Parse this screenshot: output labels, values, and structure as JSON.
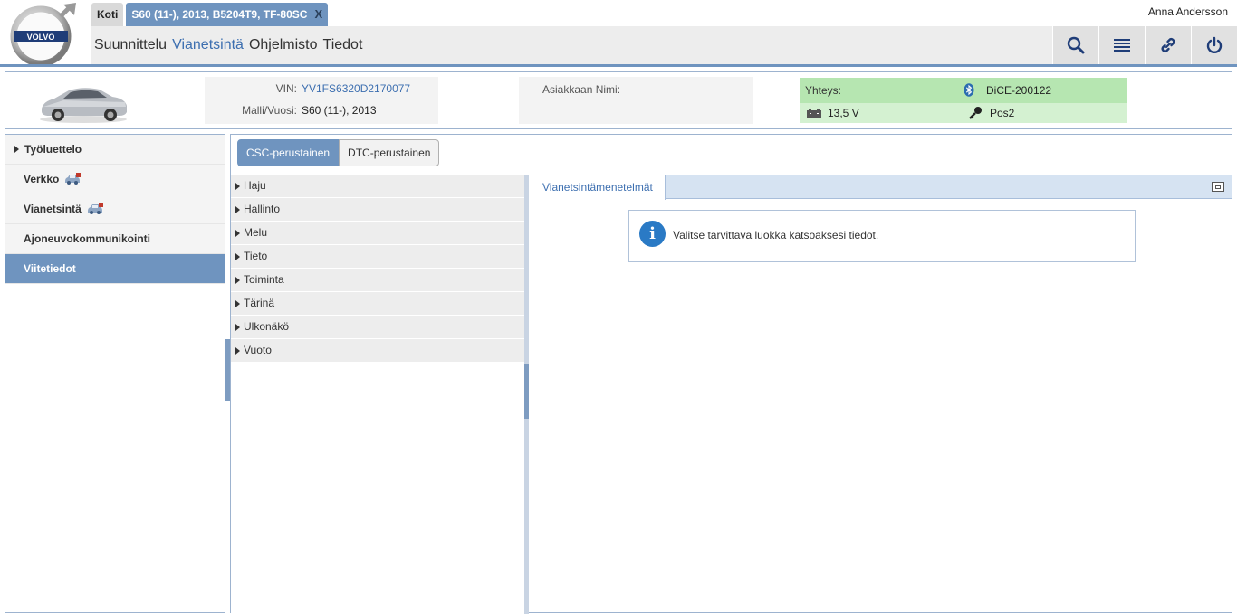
{
  "header": {
    "logo_text": "VOLVO",
    "tabs": {
      "home": "Koti",
      "vehicle": "S60 (11-), 2013, B5204T9, TF-80SC",
      "close": "X"
    },
    "user": "Anna Andersson",
    "nav": {
      "planning": "Suunnittelu",
      "diagnostics": "Vianetsintä",
      "software": "Ohjelmisto",
      "info": "Tiedot"
    },
    "toolbar_icons": [
      "search-icon",
      "list-icon",
      "link-icon",
      "power-icon"
    ]
  },
  "vehicle": {
    "vin_label": "VIN:",
    "vin": "YV1FS6320D2170077",
    "model_label": "Malli/Vuosi:",
    "model": "S60 (11-), 2013",
    "customer_label": "Asiakkaan Nimi:",
    "customer": "",
    "connection_label": "Yhteys:",
    "device": "DiCE-200122",
    "voltage": "13,5 V",
    "key_position": "Pos2"
  },
  "sidebar": {
    "items": [
      {
        "label": "Työluettelo"
      },
      {
        "label": "Verkko"
      },
      {
        "label": "Vianetsintä"
      },
      {
        "label": "Ajoneuvokommunikointi"
      },
      {
        "label": "Viitetiedot"
      }
    ],
    "active_index": 4
  },
  "content": {
    "subtabs": {
      "csc": "CSC-perustainen",
      "dtc": "DTC-perustainen"
    },
    "categories": [
      {
        "label": "Haju"
      },
      {
        "label": "Hallinto"
      },
      {
        "label": "Melu"
      },
      {
        "label": "Tieto"
      },
      {
        "label": "Toiminta"
      },
      {
        "label": "Tärinä"
      },
      {
        "label": "Ulkonäkö"
      },
      {
        "label": "Vuoto"
      }
    ],
    "method_tab": "Vianetsintämenetelmät",
    "info_message": "Valitse tarvittava luokka katsoaksesi tiedot."
  },
  "colors": {
    "accent": "#6f94bf",
    "link": "#3d6fb0",
    "connection_green": "#b6e6b1",
    "connection_green_light": "#d4f1d1",
    "info_blue": "#2a7ac5"
  }
}
